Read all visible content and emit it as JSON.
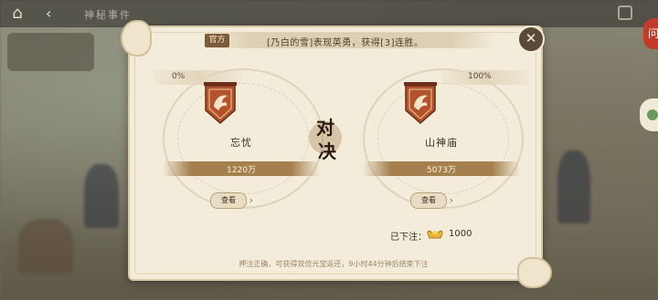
{
  "header": {
    "title": "神秘事件",
    "back_glyph": "⌂",
    "chevron_glyph": "‹"
  },
  "side_seal": "问",
  "notice": {
    "tag": "官方",
    "text": "[乃白的雪]表现英勇，获得[3]连胜。"
  },
  "close_glyph": "✕",
  "vs": {
    "char1": "对",
    "char2": "决"
  },
  "sides": [
    {
      "percent": "0%",
      "name": "忘忧",
      "amount": "1220万",
      "view_label": "查看"
    },
    {
      "percent": "100%",
      "name": "山神庙",
      "amount": "5073万",
      "view_label": "查看"
    }
  ],
  "bet": {
    "label": "已下注：",
    "value": "1000",
    "icon": "gold-ingot-icon"
  },
  "footer": "押注正确，可获得双倍元宝返还，9小时44分钟后结束下注",
  "colors": {
    "panel": "#f3ecda",
    "banner": "#b2532b",
    "accent": "#a5804e"
  }
}
